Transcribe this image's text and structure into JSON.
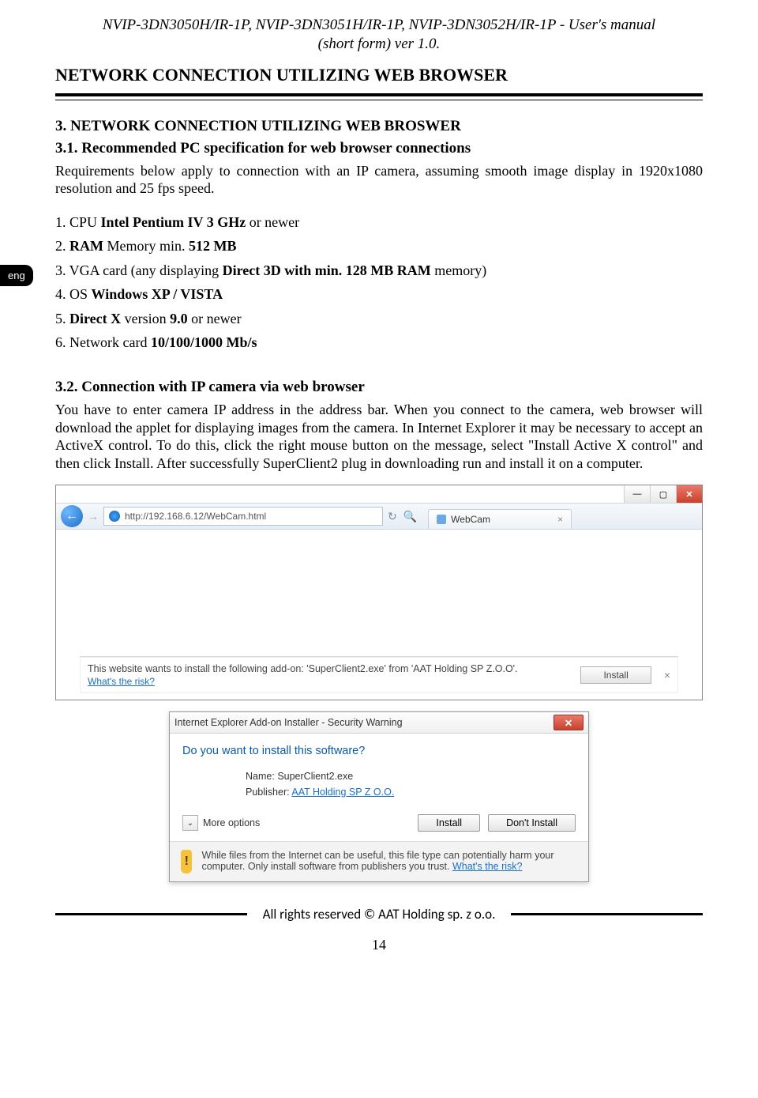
{
  "header": {
    "models": "NVIP-3DN3050H/IR-1P, NVIP-3DN3051H/IR-1P, NVIP-3DN3052H/IR-1P - User's manual",
    "subtitle": "(short form) ver 1.0."
  },
  "language_tab": "eng",
  "titles": {
    "page_title": "NETWORK CONNECTION UTILIZING WEB BROWSER",
    "h3": "3. NETWORK CONNECTION UTILIZING WEB BROSWER",
    "h31": "3.1. Recommended PC specification for web browser connections",
    "h32": "3.2. Connection with IP camera via web browser"
  },
  "paragraphs": {
    "p31": "Requirements below apply to connection with an IP camera, assuming smooth image display in 1920x1080 resolution and 25 fps speed.",
    "p32": "You have to enter camera IP address in the address bar. When you connect to the camera, web browser will download the applet for displaying images from the camera. In Internet Explorer it may be necessary to accept an ActiveX control. To do this, click the right mouse button on the message, select \"Install Active X control\" and then click Install. After successfully SuperClient2 plug in downloading run and install it on a computer."
  },
  "requirements": {
    "r1a": "1. CPU ",
    "r1b": "Intel Pentium IV 3 GHz",
    "r1c": " or newer",
    "r2a": "2. ",
    "r2b": "RAM",
    "r2c": " Memory min. ",
    "r2d": "512 MB",
    "r3a": "3. VGA card (any displaying ",
    "r3b": "Direct 3D with min. 128 MB RAM",
    "r3c": " memory)",
    "r4a": "4. OS ",
    "r4b": "Windows XP / VISTA",
    "r5a": "5. ",
    "r5b": "Direct X",
    "r5c": " version ",
    "r5d": "9.0",
    "r5e": " or newer",
    "r6a": "6. Network card ",
    "r6b": "10/100/1000 Mb/s"
  },
  "browser": {
    "address": "http://192.168.6.12/WebCam.html",
    "tab_label": "WebCam",
    "infobar_msg": "This website wants to install the following add-on: 'SuperClient2.exe' from 'AAT Holding SP Z.O.O'.",
    "infobar_risk": "What's the risk?",
    "install_btn": "Install",
    "close_x": "×",
    "win_min": "—",
    "win_max": "▢",
    "win_close": "✕"
  },
  "dialog": {
    "title": "Internet Explorer Add-on Installer - Security Warning",
    "question": "Do you want to install this software?",
    "name_label": "Name:",
    "name_value": "SuperClient2.exe",
    "publisher_label": "Publisher:",
    "publisher_value": "AAT Holding SP Z O.O.",
    "more_options": "More options",
    "install": "Install",
    "dont_install": "Don't Install",
    "warning": "While files from the Internet can be useful, this file type can potentially harm your computer. Only install software from publishers you trust. ",
    "risk_link": "What's the risk?",
    "close_x": "✕",
    "chev": "⌄"
  },
  "footer": {
    "copyright": "All rights reserved © AAT Holding sp. z o.o.",
    "page": "14"
  }
}
